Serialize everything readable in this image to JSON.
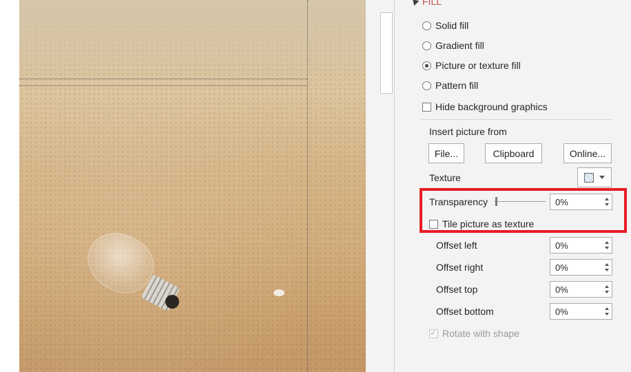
{
  "pane": {
    "section_title": "FILL",
    "fill_options": [
      {
        "label": "Solid fill",
        "selected": false
      },
      {
        "label": "Gradient fill",
        "selected": false
      },
      {
        "label": "Picture or texture fill",
        "selected": true
      },
      {
        "label": "Pattern fill",
        "selected": false
      }
    ],
    "hide_background_label": "Hide background graphics",
    "insert_picture_label": "Insert picture from",
    "buttons": {
      "file": "File...",
      "clipboard": "Clipboard",
      "online": "Online..."
    },
    "texture_label": "Texture",
    "transparency_label": "Transparency",
    "transparency_value": "0%",
    "transparency_level": 0,
    "tile_label": "Tile picture as texture",
    "offsets": [
      {
        "label": "Offset left",
        "value": "0%"
      },
      {
        "label": "Offset right",
        "value": "0%"
      },
      {
        "label": "Offset top",
        "value": "0%"
      },
      {
        "label": "Offset bottom",
        "value": "0%"
      }
    ],
    "rotate_label": "Rotate with shape",
    "rotate_checked": true
  },
  "colors": {
    "section_title": "#c0504d",
    "highlight_box": "#e81c23",
    "pane_background": "#f3f3f3"
  },
  "icons": [
    "collapse-triangle-icon",
    "texture-swatch-icon",
    "dropdown-caret-icon",
    "spin-up-icon",
    "spin-down-icon"
  ]
}
